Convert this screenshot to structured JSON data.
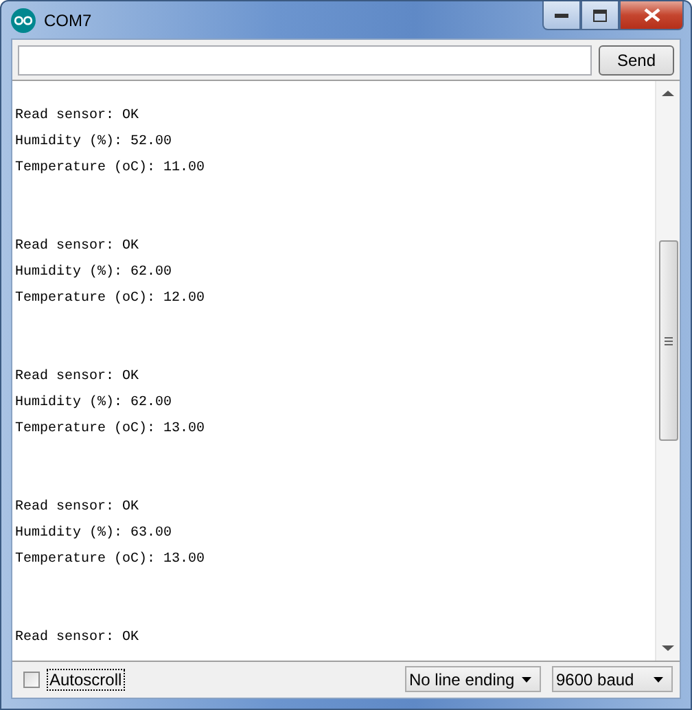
{
  "window": {
    "title": "COM7"
  },
  "send_button": "Send",
  "output": [
    {
      "lines": [
        "Read sensor: OK",
        "Humidity (%): 52.00",
        "Temperature (oC): 11.00"
      ]
    },
    {
      "lines": [
        "Read sensor: OK",
        "Humidity (%): 62.00",
        "Temperature (oC): 12.00"
      ]
    },
    {
      "lines": [
        "Read sensor: OK",
        "Humidity (%): 62.00",
        "Temperature (oC): 13.00"
      ]
    },
    {
      "lines": [
        "Read sensor: OK",
        "Humidity (%): 63.00",
        "Temperature (oC): 13.00"
      ]
    },
    {
      "lines": [
        "Read sensor: OK"
      ]
    }
  ],
  "autoscroll": {
    "label": "Autoscroll",
    "checked": false
  },
  "line_ending": "No line ending",
  "baud_rate": "9600 baud"
}
